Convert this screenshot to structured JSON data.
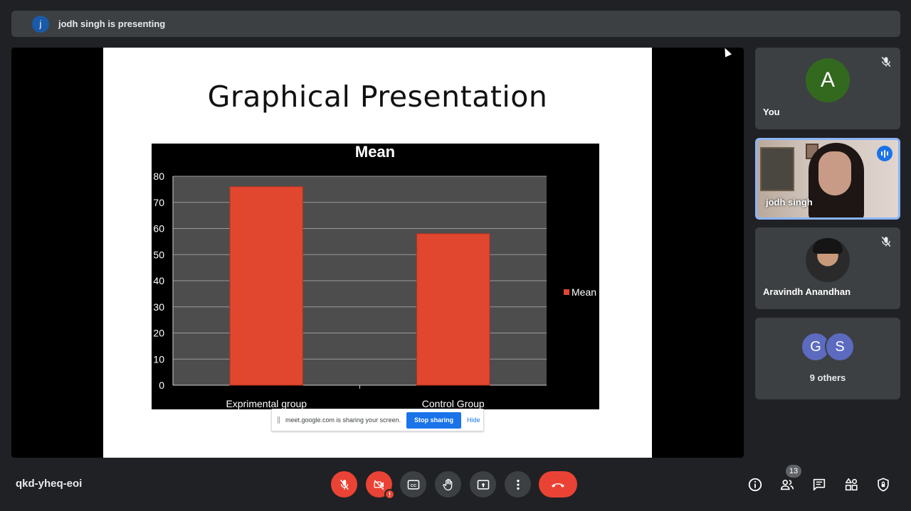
{
  "banner": {
    "avatar_letter": "j",
    "text": "jodh singh is presenting"
  },
  "slide": {
    "title": "Graphical Presentation",
    "share_notice": {
      "text": "meet.google.com is sharing your screen.",
      "stop_label": "Stop sharing",
      "hide_label": "Hide"
    }
  },
  "chart_data": {
    "type": "bar",
    "title": "Mean",
    "categories": [
      "Exprimental group",
      "Control Group"
    ],
    "series": [
      {
        "name": "Mean",
        "values": [
          76,
          58
        ]
      }
    ],
    "ylim": [
      0,
      80
    ],
    "yticks": [
      0,
      10,
      20,
      30,
      40,
      50,
      60,
      70,
      80
    ],
    "grid": true,
    "legend": "right",
    "colors": {
      "bar": "#e0472e",
      "plot_bg": "#4d4d4d",
      "frame_bg": "#000000"
    }
  },
  "participants": [
    {
      "name": "You",
      "avatar_letter": "A",
      "avatar_color": "#33691e",
      "muted": true
    },
    {
      "name": "jodh singh",
      "speaking": true
    },
    {
      "name": "Aravindh Anandhan",
      "muted": true
    },
    {
      "avatar_letters": [
        "G",
        "S"
      ],
      "label": "9 others"
    }
  ],
  "bottom_bar": {
    "meeting_code": "qkd-yheq-eoi",
    "warning_mark": "!",
    "people_count": "13",
    "icons": [
      "mic-off-icon",
      "camera-off-icon",
      "captions-icon",
      "raise-hand-icon",
      "present-icon",
      "more-icon",
      "end-call-icon",
      "info-icon",
      "people-icon",
      "chat-icon",
      "activities-icon",
      "host-controls-icon"
    ]
  }
}
